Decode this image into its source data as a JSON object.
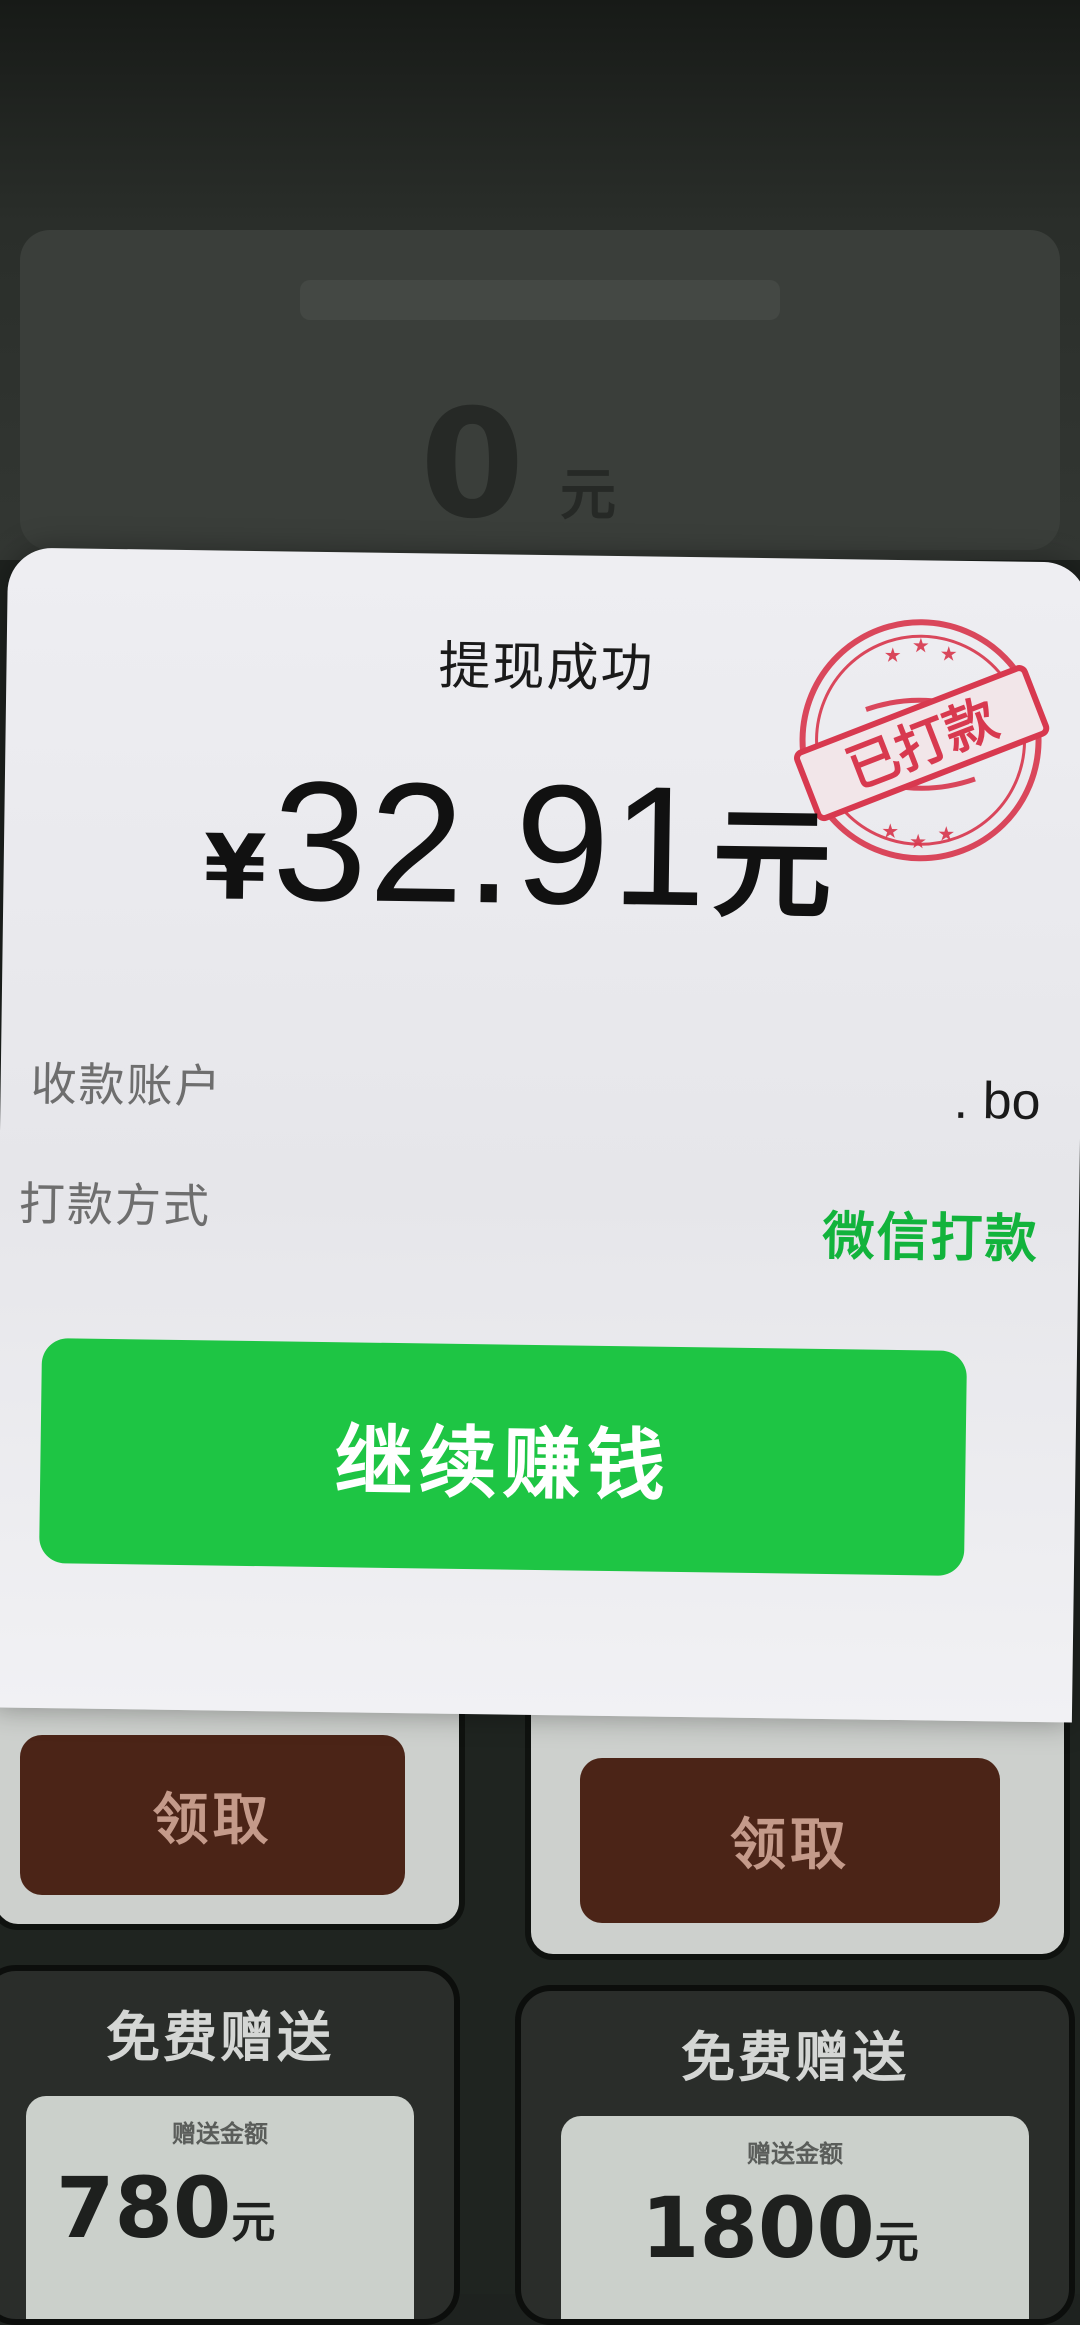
{
  "background": {
    "balance_value": "0",
    "balance_unit": "元",
    "claim_left_label": "领取",
    "claim_right_label": "领取",
    "gift_left": {
      "title": "免费赠送",
      "label": "赠送金额",
      "amount": "780",
      "unit": "元"
    },
    "gift_right": {
      "title": "免费赠送",
      "label": "赠送金额",
      "amount": "1800",
      "unit": "元"
    }
  },
  "dialog": {
    "title": "提现成功",
    "currency_symbol": "¥",
    "amount": "32.91",
    "amount_unit": "元",
    "stamp_text": "已打款",
    "account_label": "收款账户",
    "account_value": ". bo",
    "method_label": "打款方式",
    "method_value": "微信打款",
    "continue_button": "继续赚钱"
  },
  "colors": {
    "primary_green": "#1ec544",
    "method_green": "#12b33c",
    "stamp_red": "#d8394f",
    "claim_button": "#4b2417"
  }
}
